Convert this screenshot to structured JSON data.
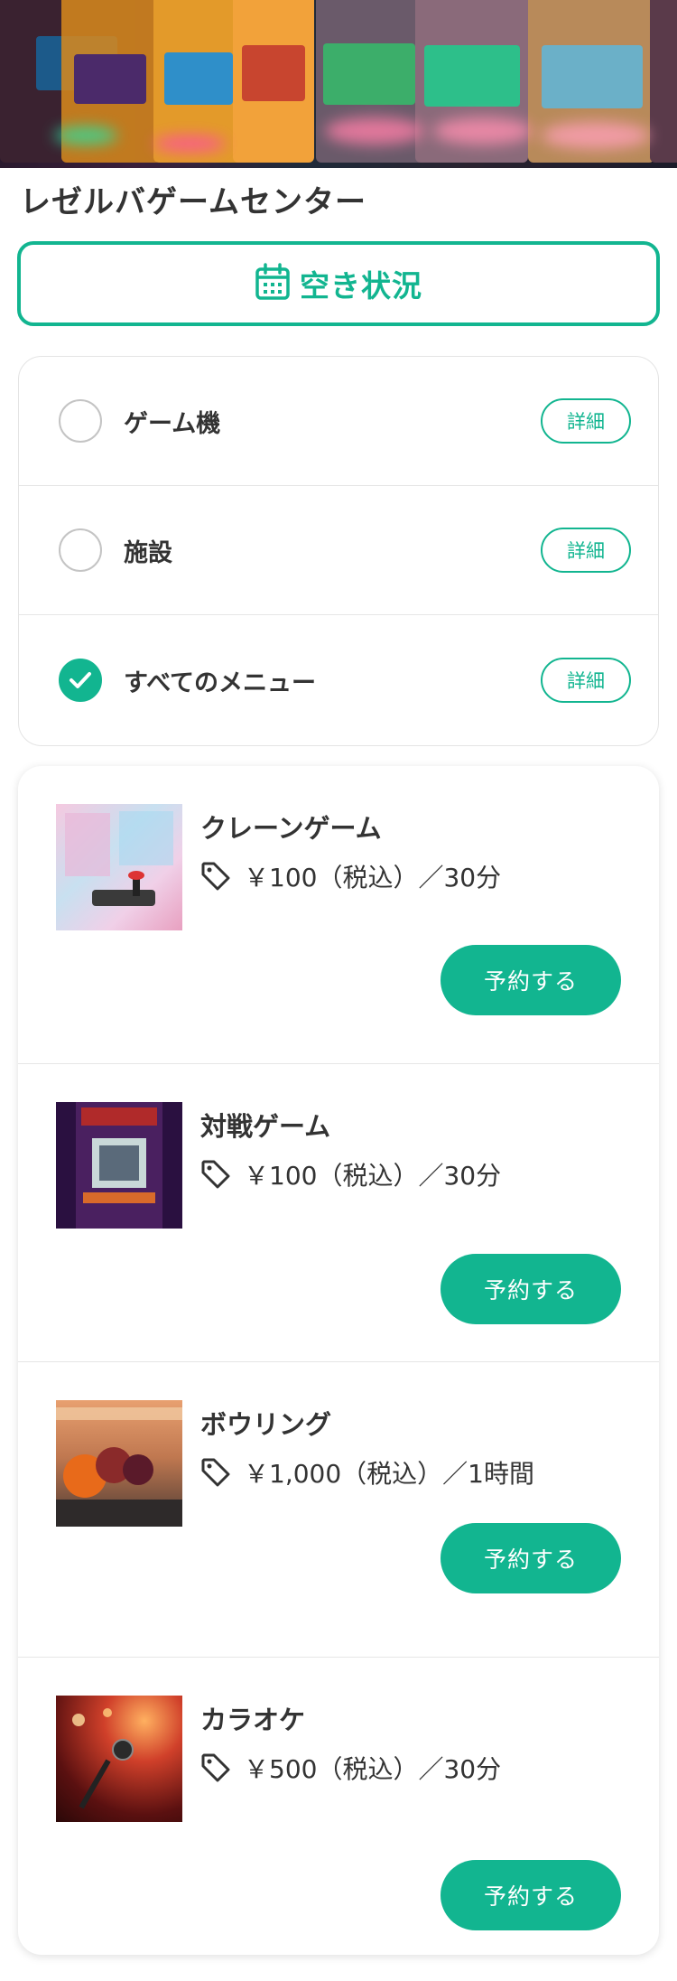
{
  "shop": {
    "name": "レゼルバゲームセンター"
  },
  "availability": {
    "label": "空き状況",
    "icon": "calendar-icon"
  },
  "filters": [
    {
      "label": "ゲーム機",
      "checked": false,
      "detail_label": "詳細"
    },
    {
      "label": "施設",
      "checked": false,
      "detail_label": "詳細"
    },
    {
      "label": "すべてのメニュー",
      "checked": true,
      "detail_label": "詳細"
    }
  ],
  "menu": [
    {
      "name": "クレーンゲーム",
      "price": "￥100（税込）／30分",
      "button": "予約する"
    },
    {
      "name": "対戦ゲーム",
      "price": "￥100（税込）／30分",
      "button": "予約する"
    },
    {
      "name": "ボウリング",
      "price": "￥1,000（税込）／1時間",
      "button": "予約する"
    },
    {
      "name": "カラオケ",
      "price": "￥500（税込）／30分",
      "button": "予約する"
    }
  ],
  "colors": {
    "accent": "#12b590",
    "text": "#333333",
    "border": "#e4e4e4"
  }
}
